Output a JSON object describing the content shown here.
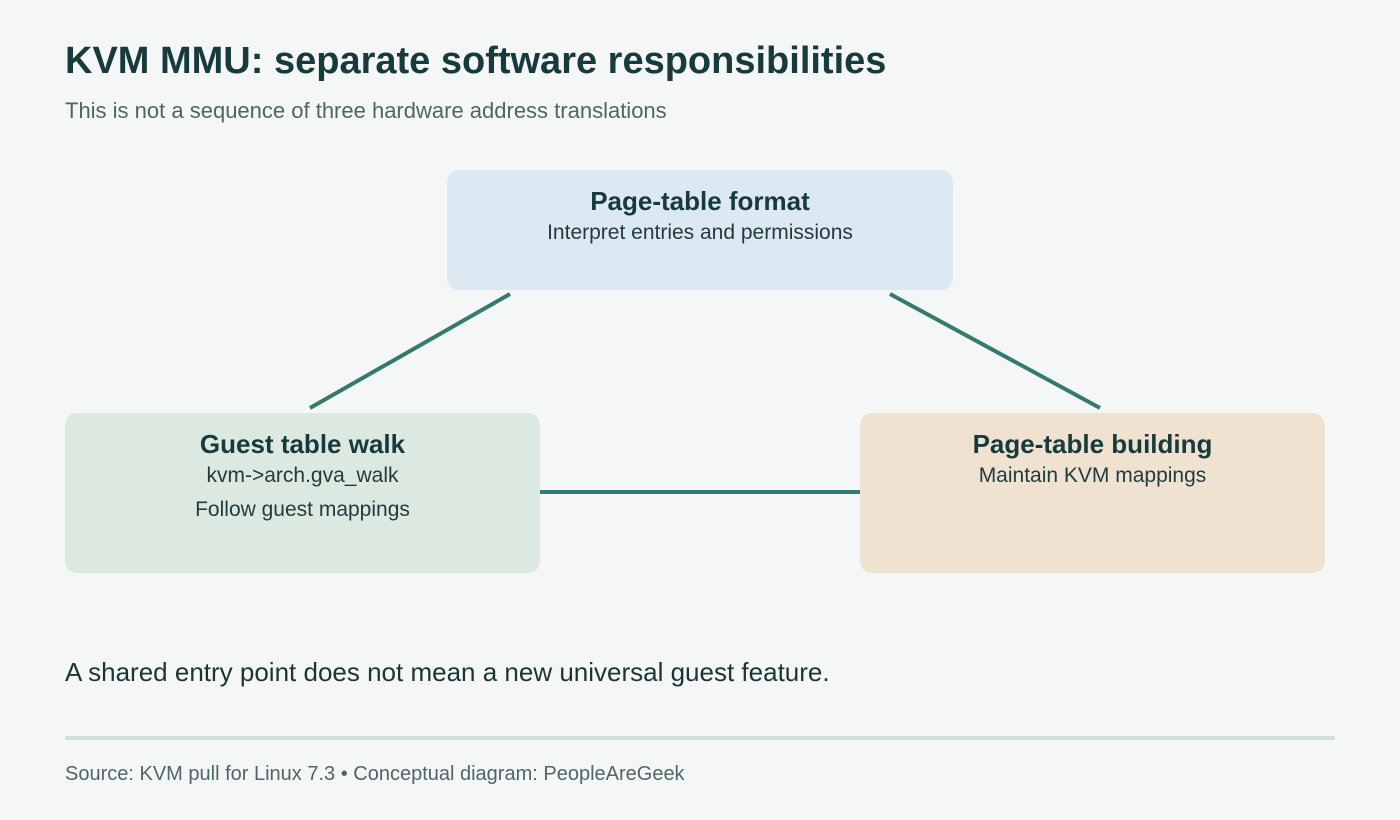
{
  "header": {
    "title": "KVM MMU: separate software responsibilities",
    "subtitle": "This is not a sequence of three hardware address translations"
  },
  "diagram": {
    "nodes": {
      "format": {
        "title": "Page-table format",
        "lines": [
          "Interpret entries and permissions"
        ]
      },
      "walk": {
        "title": "Guest table walk",
        "lines": [
          "kvm->arch.gva_walk",
          "Follow guest mappings"
        ]
      },
      "build": {
        "title": "Page-table building",
        "lines": [
          "Maintain KVM mappings"
        ]
      }
    },
    "edges": [
      {
        "from": "format",
        "to": "walk"
      },
      {
        "from": "format",
        "to": "build"
      },
      {
        "from": "walk",
        "to": "build"
      }
    ],
    "colors": {
      "connector": "#347a6e",
      "format_fill": "#dce9f2",
      "walk_fill": "#dbe9e1",
      "build_fill": "#efe2d1"
    }
  },
  "note": "A shared entry point does not mean a new universal guest feature.",
  "footer": "Source: KVM pull for Linux 7.3 • Conceptual diagram: PeopleAreGeek"
}
